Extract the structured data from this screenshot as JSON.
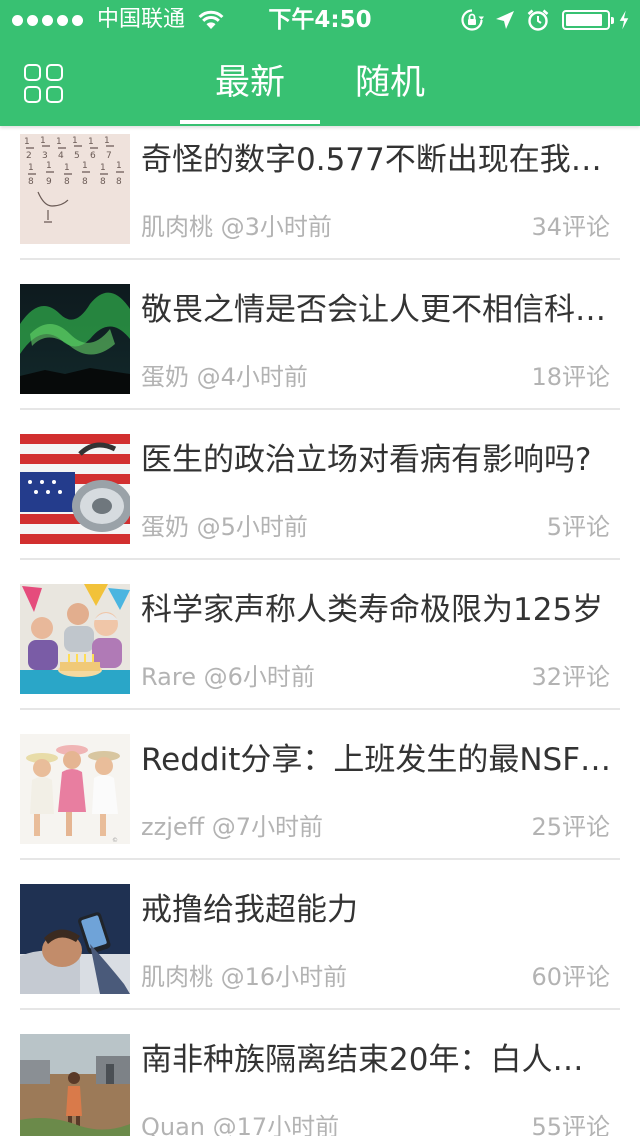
{
  "status_bar": {
    "carrier": "中国联通",
    "time": "下午4:50",
    "battery_level": 0.9
  },
  "nav": {
    "tabs": [
      {
        "label": "最新",
        "active": true
      },
      {
        "label": "随机",
        "active": false
      }
    ]
  },
  "articles": [
    {
      "title": "奇怪的数字0.577不断出现在我…",
      "meta": "肌肉桃 @3小时前",
      "comments": "34评论",
      "thumb": "fractions-notes"
    },
    {
      "title": "敬畏之情是否会让人更不相信科…",
      "meta": "蛋奶 @4小时前",
      "comments": "18评论",
      "thumb": "aurora"
    },
    {
      "title": "医生的政治立场对看病有影响吗?",
      "meta": "蛋奶 @5小时前",
      "comments": "5评论",
      "thumb": "flag-stethoscope"
    },
    {
      "title": "科学家声称人类寿命极限为125岁",
      "meta": "Rare @6小时前",
      "comments": "32评论",
      "thumb": "birthday-party"
    },
    {
      "title": "Reddit分享：上班发生的最NSF…",
      "meta": "zzjeff @7小时前",
      "comments": "25评论",
      "thumb": "friends-laughing"
    },
    {
      "title": "戒撸给我超能力",
      "meta": "肌肉桃 @16小时前",
      "comments": "60评论",
      "thumb": "man-phone-bed"
    },
    {
      "title": "南非种族隔离结束20年：白人…",
      "meta": "Quan @17小时前",
      "comments": "55评论",
      "thumb": "township"
    }
  ],
  "colors": {
    "accent": "#38c172",
    "title_text": "#333333",
    "meta_text": "#b3b3b3",
    "divider": "#e6e6e6"
  }
}
